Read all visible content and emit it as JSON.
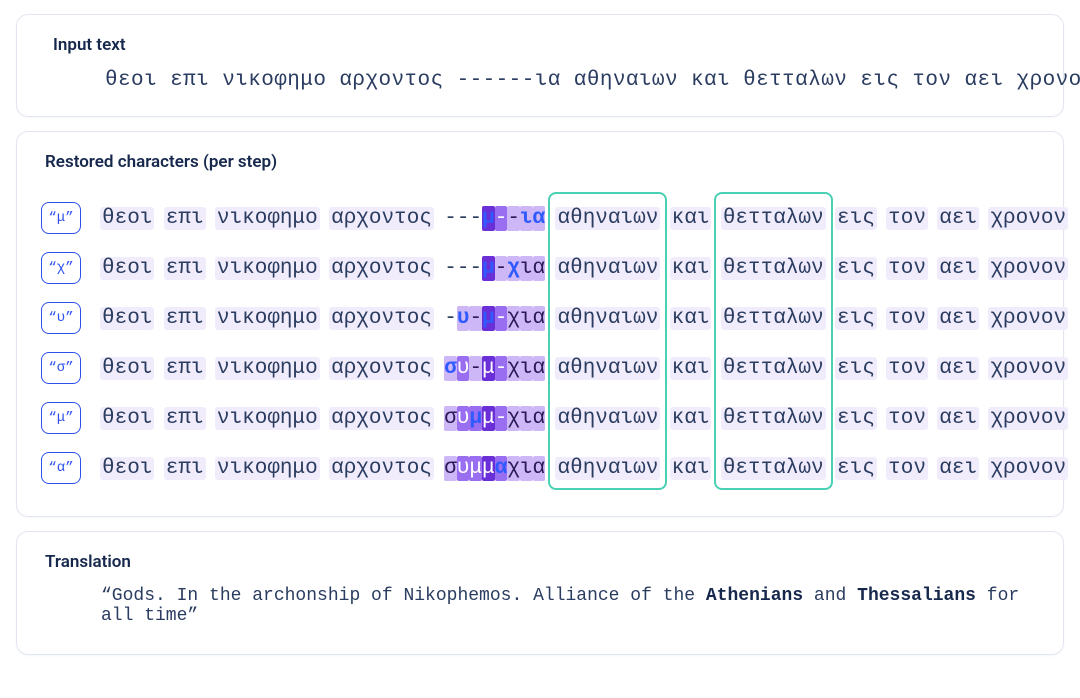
{
  "panels": {
    "input": {
      "heading": "Input text",
      "text": "θεοι επι νικοφημο αρχοντος ------ια αθηναιων και θετταλων εις τον αει χρονον"
    },
    "steps": {
      "heading": "Restored characters (per step)",
      "prefix_words": [
        "θεοι",
        "επι",
        "νικοφημο",
        "αρχοντος"
      ],
      "suffix_words": [
        "αθηναιων",
        "και",
        "θετταλων",
        "εις",
        "τον",
        "αει",
        "χρονον"
      ],
      "focus_words": [
        "αθηναιων",
        "θετταλων"
      ],
      "rows": [
        {
          "chip": "“μ”",
          "blank": [
            {
              "t": "-"
            },
            {
              "t": "-"
            },
            {
              "t": "-"
            },
            {
              "t": "μ",
              "blue": true,
              "hl": "deep"
            },
            {
              "t": "-",
              "hl": "med"
            },
            {
              "t": "-",
              "hl": "lite"
            },
            {
              "t": "ι",
              "blue": true,
              "hl": "lite"
            },
            {
              "t": "α",
              "blue": true,
              "hl": "lite"
            }
          ]
        },
        {
          "chip": "“χ”",
          "blank": [
            {
              "t": "-"
            },
            {
              "t": "-"
            },
            {
              "t": "-"
            },
            {
              "t": "μ",
              "blue": true,
              "hl": "deep"
            },
            {
              "t": "-",
              "hl": "lite"
            },
            {
              "t": "χ",
              "blue": true,
              "hl": "lite"
            },
            {
              "t": "ι",
              "hl": "lite"
            },
            {
              "t": "α",
              "hl": "lite"
            }
          ]
        },
        {
          "chip": "“υ”",
          "blank": [
            {
              "t": "-"
            },
            {
              "t": "υ",
              "blue": true,
              "hl": "lite"
            },
            {
              "t": "-",
              "hl": "lite"
            },
            {
              "t": "μ",
              "blue": true,
              "hl": "deep"
            },
            {
              "t": "-",
              "hl": "med"
            },
            {
              "t": "χ",
              "hl": "lite"
            },
            {
              "t": "ι",
              "hl": "lite"
            },
            {
              "t": "α",
              "hl": "lite"
            }
          ]
        },
        {
          "chip": "“σ”",
          "blank": [
            {
              "t": "σ",
              "blue": true,
              "hl": "lite"
            },
            {
              "t": "υ",
              "hl": "med"
            },
            {
              "t": "-",
              "hl": "lite"
            },
            {
              "t": "μ",
              "hl": "deep"
            },
            {
              "t": "-",
              "hl": "med"
            },
            {
              "t": "χ",
              "hl": "lite"
            },
            {
              "t": "ι",
              "hl": "lite"
            },
            {
              "t": "α",
              "hl": "lite"
            }
          ]
        },
        {
          "chip": "“μ”",
          "blank": [
            {
              "t": "σ",
              "hl": "lite"
            },
            {
              "t": "υ",
              "hl": "med"
            },
            {
              "t": "μ",
              "blue": true,
              "hl": "med"
            },
            {
              "t": "μ",
              "hl": "deep"
            },
            {
              "t": "-",
              "hl": "med"
            },
            {
              "t": "χ",
              "hl": "lite"
            },
            {
              "t": "ι",
              "hl": "lite"
            },
            {
              "t": "α",
              "hl": "lite"
            }
          ]
        },
        {
          "chip": "“α”",
          "blank": [
            {
              "t": "σ",
              "hl": "lite"
            },
            {
              "t": "υ",
              "hl": "med"
            },
            {
              "t": "μ",
              "hl": "med"
            },
            {
              "t": "μ",
              "hl": "deep"
            },
            {
              "t": "α",
              "blue": true,
              "hl": "med"
            },
            {
              "t": "χ",
              "hl": "lite"
            },
            {
              "t": "ι",
              "hl": "lite"
            },
            {
              "t": "α",
              "hl": "lite"
            }
          ]
        }
      ]
    },
    "translation": {
      "heading": "Translation",
      "segments": [
        {
          "t": "“Gods. In the archonship of Nikophemos. Alliance of the "
        },
        {
          "t": "Athenians",
          "bold": true
        },
        {
          "t": " and "
        },
        {
          "t": "Thessalians",
          "bold": true
        },
        {
          "t": " for all time”"
        }
      ]
    }
  }
}
